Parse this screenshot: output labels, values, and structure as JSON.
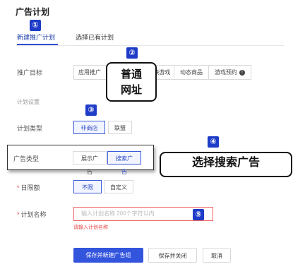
{
  "page": {
    "title": "广告计划"
  },
  "tabs": [
    {
      "label": "新建推广计划",
      "active": true
    },
    {
      "label": "选择已有计划",
      "active": false
    }
  ],
  "badges": [
    "①",
    "②",
    "③",
    "④",
    "⑤"
  ],
  "promo_goal": {
    "label": "推广目标",
    "options": [
      "应用推广",
      "快应用/快游戏",
      "动态商品",
      "游戏预约"
    ],
    "info_icon": "!"
  },
  "callout_url": {
    "line1": "普通",
    "line2": "网址"
  },
  "section_plan_settings": "计划设置",
  "plan_type": {
    "label": "计划类型",
    "options": [
      "非商店",
      "联盟"
    ],
    "selected": "非商店"
  },
  "ad_type": {
    "label": "广告类型",
    "options": [
      "展示广告",
      "搜索广告"
    ],
    "selected": "搜索广告"
  },
  "callout_search": "选择搜索广告",
  "daily_budget": {
    "required_mark": "*",
    "label": "日限额",
    "options": [
      "不限",
      "自定义"
    ],
    "selected": "不限"
  },
  "plan_name": {
    "required_mark": "*",
    "label": "计划名称",
    "placeholder": "输入计划名称 200个字符以内",
    "error": "请输入计划名称"
  },
  "actions": {
    "primary": "保存并新建广告组",
    "save_close": "保存并关闭",
    "cancel": "取消"
  },
  "colors": {
    "accent": "#3354dd",
    "badge": "#1e3cc8",
    "error": "#e54545"
  }
}
